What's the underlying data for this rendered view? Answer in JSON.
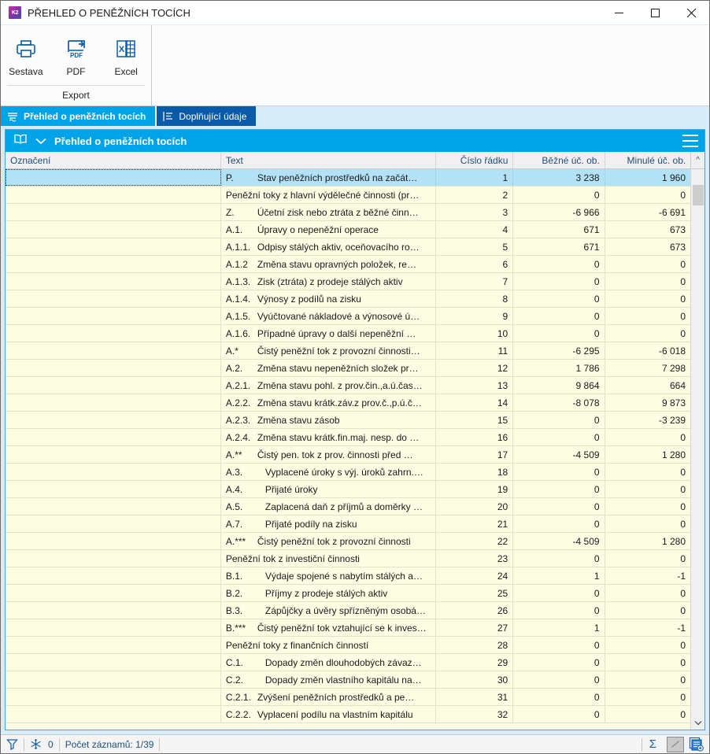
{
  "window": {
    "title": "PŘEHLED O PENĚŽNÍCH TOCÍCH",
    "app_icon": "k2-app-icon",
    "icon_text": "K2",
    "minimize": "minimize-button",
    "maximize": "maximize-button",
    "close": "close-button"
  },
  "ribbon": {
    "group_title": "Export",
    "buttons": [
      {
        "label": "Sestava",
        "icon": "printer-icon"
      },
      {
        "label": "PDF",
        "icon": "pdf-export-icon"
      },
      {
        "label": "Excel",
        "icon": "excel-export-icon"
      }
    ]
  },
  "tabs": [
    {
      "label": "Přehled o peněžních tocích",
      "icon": "overview-icon",
      "active": true
    },
    {
      "label": "Doplňující údaje",
      "icon": "list-icon",
      "active": false
    }
  ],
  "grid": {
    "header_title": "Přehled o peněžních tocích",
    "header_icon": "book-icon",
    "collapse_icon": "chevron-down-icon",
    "menu_icon": "hamburger-icon",
    "columns": [
      "Označení",
      "Text",
      "Číslo řádku",
      "Běžné úč. ob.",
      "Minulé úč. ob."
    ],
    "sort_indicator": "^",
    "rows": [
      {
        "oznaceni": "",
        "code": "P.",
        "desc": "Stav peněžních prostředků na začát…",
        "cislo": "1",
        "bezne": "3 238",
        "minule": "1 960",
        "selected": true
      },
      {
        "oznaceni": "",
        "code": "",
        "desc": "Peněžní toky z hlavní výdělečné činnosti (pr…",
        "cislo": "2",
        "bezne": "0",
        "minule": "0",
        "selected": false,
        "nocode": true
      },
      {
        "oznaceni": "",
        "code": "Z.",
        "desc": "Účetní zisk nebo ztráta z běžné činn…",
        "cislo": "3",
        "bezne": "-6 966",
        "minule": "-6 691",
        "selected": false
      },
      {
        "oznaceni": "",
        "code": "A.1.",
        "desc": "Úpravy o nepeněžní operace",
        "cislo": "4",
        "bezne": "671",
        "minule": "673",
        "selected": false
      },
      {
        "oznaceni": "",
        "code": "A.1.1.",
        "desc": "Odpisy stálých aktiv, oceňovacího ro…",
        "cislo": "5",
        "bezne": "671",
        "minule": "673",
        "selected": false
      },
      {
        "oznaceni": "",
        "code": "A.1.2",
        "desc": "Změna stavu opravných položek, re…",
        "cislo": "6",
        "bezne": "0",
        "minule": "0",
        "selected": false
      },
      {
        "oznaceni": "",
        "code": "A.1.3.",
        "desc": "Zisk (ztráta) z prodeje stálých aktiv",
        "cislo": "7",
        "bezne": "0",
        "minule": "0",
        "selected": false
      },
      {
        "oznaceni": "",
        "code": "A.1.4.",
        "desc": "Výnosy z podílů na zisku",
        "cislo": "8",
        "bezne": "0",
        "minule": "0",
        "selected": false
      },
      {
        "oznaceni": "",
        "code": "A.1.5.",
        "desc": "Vyúčtované nákladové a výnosové ú…",
        "cislo": "9",
        "bezne": "0",
        "minule": "0",
        "selected": false
      },
      {
        "oznaceni": "",
        "code": "A.1.6.",
        "desc": "Případné úpravy o další nepeněžní …",
        "cislo": "10",
        "bezne": "0",
        "minule": "0",
        "selected": false
      },
      {
        "oznaceni": "",
        "code": "A.*",
        "desc": "Čistý peněžní tok z provozní činnosti…",
        "cislo": "11",
        "bezne": "-6 295",
        "minule": "-6 018",
        "selected": false
      },
      {
        "oznaceni": "",
        "code": "A.2.",
        "desc": "Změna stavu nepeněžních složek pr…",
        "cislo": "12",
        "bezne": "1 786",
        "minule": "7 298",
        "selected": false
      },
      {
        "oznaceni": "",
        "code": "A.2.1.",
        "desc": "Změna stavu pohl. z prov.čin.,a.ú.čas…",
        "cislo": "13",
        "bezne": "9 864",
        "minule": "664",
        "selected": false
      },
      {
        "oznaceni": "",
        "code": "A.2.2.",
        "desc": "Změna stavu krátk.záv.z prov.č.,p.ú.č…",
        "cislo": "14",
        "bezne": "-8 078",
        "minule": "9 873",
        "selected": false
      },
      {
        "oznaceni": "",
        "code": "A.2.3.",
        "desc": "Změna stavu zásob",
        "cislo": "15",
        "bezne": "0",
        "minule": "-3 239",
        "selected": false
      },
      {
        "oznaceni": "",
        "code": "A.2.4.",
        "desc": "Změna stavu krátk.fin.maj. nesp. do …",
        "cislo": "16",
        "bezne": "0",
        "minule": "0",
        "selected": false
      },
      {
        "oznaceni": "",
        "code": "A.**",
        "desc": "Čistý pen. tok z prov. činnosti před …",
        "cislo": "17",
        "bezne": "-4 509",
        "minule": "1 280",
        "selected": false
      },
      {
        "oznaceni": "",
        "code": "A.3.",
        "desc": "Vyplacené úroky s výj. úroků zahrn.…",
        "cislo": "18",
        "bezne": "0",
        "minule": "0",
        "selected": false,
        "indent": true
      },
      {
        "oznaceni": "",
        "code": "A.4.",
        "desc": "Přijaté úroky",
        "cislo": "19",
        "bezne": "0",
        "minule": "0",
        "selected": false,
        "indent": true
      },
      {
        "oznaceni": "",
        "code": "A.5.",
        "desc": "Zaplacená daň z příjmů a doměrky …",
        "cislo": "20",
        "bezne": "0",
        "minule": "0",
        "selected": false,
        "indent": true
      },
      {
        "oznaceni": "",
        "code": "A.7.",
        "desc": "Přijaté podíly na zisku",
        "cislo": "21",
        "bezne": "0",
        "minule": "0",
        "selected": false,
        "indent": true
      },
      {
        "oznaceni": "",
        "code": "A.***",
        "desc": "Čistý peněžní tok z provozní činnosti",
        "cislo": "22",
        "bezne": "-4 509",
        "minule": "1 280",
        "selected": false
      },
      {
        "oznaceni": "",
        "code": "",
        "desc": "Peněžní tok z investiční činnosti",
        "cislo": "23",
        "bezne": "0",
        "minule": "0",
        "selected": false,
        "nocode": true
      },
      {
        "oznaceni": "",
        "code": "B.1.",
        "desc": "Výdaje spojené s nabytím stálých a…",
        "cislo": "24",
        "bezne": "1",
        "minule": "-1",
        "selected": false,
        "indent": true
      },
      {
        "oznaceni": "",
        "code": "B.2.",
        "desc": "Příjmy z prodeje stálých aktiv",
        "cislo": "25",
        "bezne": "0",
        "minule": "0",
        "selected": false,
        "indent": true
      },
      {
        "oznaceni": "",
        "code": "B.3.",
        "desc": "Zápůjčky a úvěry spřízněným osobá…",
        "cislo": "26",
        "bezne": "0",
        "minule": "0",
        "selected": false,
        "indent": true
      },
      {
        "oznaceni": "",
        "code": "B.***",
        "desc": "Čistý peněžní tok vztahující se k inves…",
        "cislo": "27",
        "bezne": "1",
        "minule": "-1",
        "selected": false
      },
      {
        "oznaceni": "",
        "code": "",
        "desc": "Peněžní toky z finančních činností",
        "cislo": "28",
        "bezne": "0",
        "minule": "0",
        "selected": false,
        "nocode": true
      },
      {
        "oznaceni": "",
        "code": "C.1.",
        "desc": "Dopady změn dlouhodobých závaz…",
        "cislo": "29",
        "bezne": "0",
        "minule": "0",
        "selected": false,
        "indent": true
      },
      {
        "oznaceni": "",
        "code": "C.2.",
        "desc": "Dopady změn vlastního kapitálu na…",
        "cislo": "30",
        "bezne": "0",
        "minule": "0",
        "selected": false,
        "indent": true
      },
      {
        "oznaceni": "",
        "code": "C.2.1.",
        "desc": "Zvýšení peněžních prostředků a pe…",
        "cislo": "31",
        "bezne": "0",
        "minule": "0",
        "selected": false
      },
      {
        "oznaceni": "",
        "code": "C.2.2.",
        "desc": "Vyplacení podílu na vlastním kapitálu",
        "cislo": "32",
        "bezne": "0",
        "minule": "0",
        "selected": false
      }
    ]
  },
  "statusbar": {
    "filter_icon": "filter-icon",
    "snowflake_icon": "snowflake-icon",
    "snowflake_count": "0",
    "record_count_label": "Počet záznamů: 1/39",
    "sum_icon": "sigma-icon",
    "edit_icon": "pencil-icon",
    "addview_icon": "add-view-icon"
  },
  "colors": {
    "accent": "#00a2e8",
    "tab_inactive": "#0b5aa8",
    "panel_bg": "#d6ecf7",
    "row_bg": "#fdfde4",
    "row_selected": "#b3e2f7"
  }
}
